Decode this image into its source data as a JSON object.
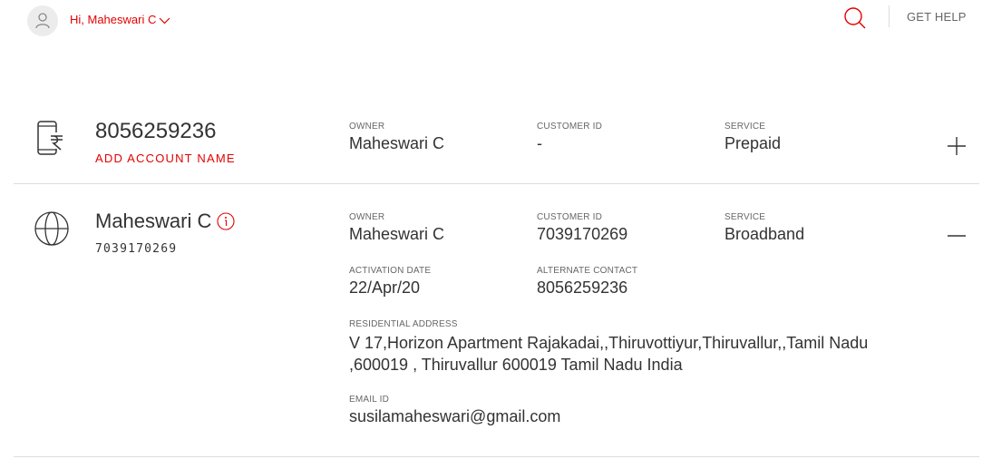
{
  "header": {
    "greeting": "Hi, Maheswari C",
    "get_help_label": "GET HELP",
    "icons": {
      "avatar": "user-icon",
      "dropdown": "chevron-down-icon",
      "search": "search-icon"
    }
  },
  "accounts": [
    {
      "number": "8056259236",
      "add_name_label": "ADD ACCOUNT NAME",
      "icon": "mobile-rupee-icon",
      "toggle_icon": "plus-icon",
      "fields": {
        "owner": {
          "label": "OWNER",
          "value": "Maheswari C"
        },
        "customer_id": {
          "label": "CUSTOMER ID",
          "value": "-"
        },
        "service": {
          "label": "SERVICE",
          "value": "Prepaid"
        }
      }
    },
    {
      "name": "Maheswari C",
      "number": "7039170269",
      "icon": "globe-icon",
      "info_icon": "info-icon",
      "toggle_icon": "minus-icon",
      "fields": {
        "owner": {
          "label": "OWNER",
          "value": "Maheswari C"
        },
        "customer_id": {
          "label": "CUSTOMER ID",
          "value": "7039170269"
        },
        "service": {
          "label": "SERVICE",
          "value": "Broadband"
        },
        "activation_date": {
          "label": "ACTIVATION DATE",
          "value": "22/Apr/20"
        },
        "alternate_contact": {
          "label": "ALTERNATE CONTACT",
          "value": "8056259236"
        },
        "residential_address": {
          "label": "RESIDENTIAL ADDRESS",
          "value": "V 17,Horizon Apartment Rajakadai,,Thiruvottiyur,Thiruvallur,,Tamil Nadu ,600019 , Thiruvallur 600019 Tamil Nadu India"
        },
        "email": {
          "label": "EMAIL ID",
          "value": "susilamaheswari@gmail.com"
        }
      }
    }
  ],
  "colors": {
    "accent": "#e40000",
    "text": "#333333",
    "muted": "#666666",
    "divider": "#dddddd"
  }
}
